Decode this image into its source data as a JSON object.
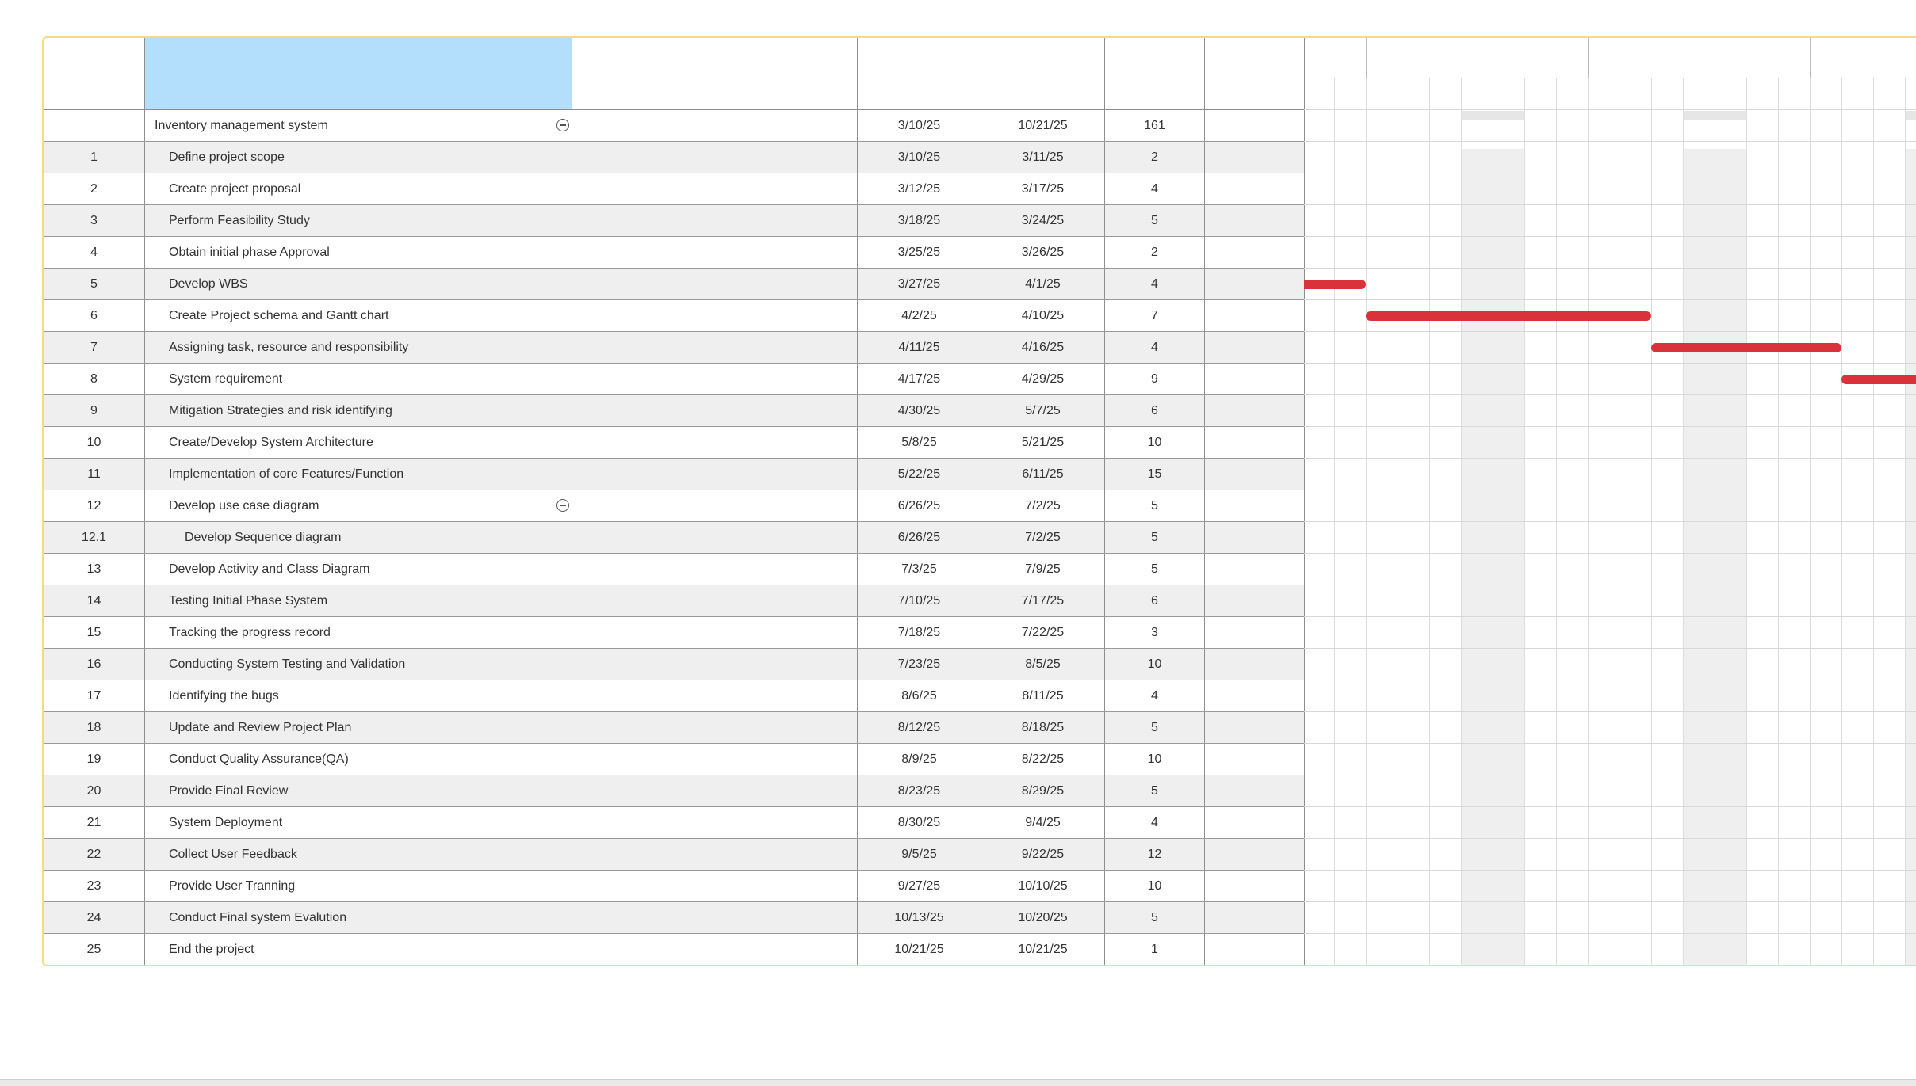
{
  "project": {
    "name": "Inventory management system",
    "start": "3/10/25",
    "finish": "10/21/25",
    "duration": "161"
  },
  "tasks": [
    {
      "id": "1",
      "name": "Define project scope",
      "start": "3/10/25",
      "finish": "3/11/25",
      "duration": "2"
    },
    {
      "id": "2",
      "name": "Create project proposal",
      "start": "3/12/25",
      "finish": "3/17/25",
      "duration": "4"
    },
    {
      "id": "3",
      "name": "Perform Feasibility Study",
      "start": "3/18/25",
      "finish": "3/24/25",
      "duration": "5"
    },
    {
      "id": "4",
      "name": "Obtain initial phase Approval",
      "start": "3/25/25",
      "finish": "3/26/25",
      "duration": "2"
    },
    {
      "id": "5",
      "name": "Develop WBS",
      "start": "3/27/25",
      "finish": "4/1/25",
      "duration": "4"
    },
    {
      "id": "6",
      "name": "Create Project schema and Gantt chart",
      "start": "4/2/25",
      "finish": "4/10/25",
      "duration": "7"
    },
    {
      "id": "7",
      "name": "Assigning task, resource and responsibility",
      "start": "4/11/25",
      "finish": "4/16/25",
      "duration": "4"
    },
    {
      "id": "8",
      "name": "System requirement",
      "start": "4/17/25",
      "finish": "4/29/25",
      "duration": "9"
    },
    {
      "id": "9",
      "name": "Mitigation Strategies and risk identifying",
      "start": "4/30/25",
      "finish": "5/7/25",
      "duration": "6"
    },
    {
      "id": "10",
      "name": "Create/Develop System Architecture",
      "start": "5/8/25",
      "finish": "5/21/25",
      "duration": "10"
    },
    {
      "id": "11",
      "name": "Implementation of core Features/Function",
      "start": "5/22/25",
      "finish": "6/11/25",
      "duration": "15"
    },
    {
      "id": "12",
      "name": "Develop use case diagram",
      "start": "6/26/25",
      "finish": "7/2/25",
      "duration": "5",
      "collapsible": true
    },
    {
      "id": "12.1",
      "name": "Develop Sequence diagram",
      "start": "6/26/25",
      "finish": "7/2/25",
      "duration": "5",
      "sub": true
    },
    {
      "id": "13",
      "name": "Develop Activity and Class Diagram",
      "start": "7/3/25",
      "finish": "7/9/25",
      "duration": "5"
    },
    {
      "id": "14",
      "name": "Testing Initial Phase System",
      "start": "7/10/25",
      "finish": "7/17/25",
      "duration": "6"
    },
    {
      "id": "15",
      "name": "Tracking the progress record",
      "start": "7/18/25",
      "finish": "7/22/25",
      "duration": "3"
    },
    {
      "id": "16",
      "name": "Conducting System Testing and Validation",
      "start": "7/23/25",
      "finish": "8/5/25",
      "duration": "10"
    },
    {
      "id": "17",
      "name": "Identifying the bugs",
      "start": "8/6/25",
      "finish": "8/11/25",
      "duration": "4"
    },
    {
      "id": "18",
      "name": "Update and Review Project Plan",
      "start": "8/12/25",
      "finish": "8/18/25",
      "duration": "5"
    },
    {
      "id": "19",
      "name": "Conduct Quality Assurance(QA)",
      "start": "8/9/25",
      "finish": "8/22/25",
      "duration": "10"
    },
    {
      "id": "20",
      "name": "Provide Final Review",
      "start": "8/23/25",
      "finish": "8/29/25",
      "duration": "5"
    },
    {
      "id": "21",
      "name": "System Deployment",
      "start": "8/30/25",
      "finish": "9/4/25",
      "duration": "4"
    },
    {
      "id": "22",
      "name": "Collect User Feedback",
      "start": "9/5/25",
      "finish": "9/22/25",
      "duration": "12"
    },
    {
      "id": "23",
      "name": "Provide User Tranning",
      "start": "9/27/25",
      "finish": "10/10/25",
      "duration": "10"
    },
    {
      "id": "24",
      "name": "Conduct Final system Evalution",
      "start": "10/13/25",
      "finish": "10/20/25",
      "duration": "5"
    },
    {
      "id": "25",
      "name": "End the project",
      "start": "10/21/25",
      "finish": "10/21/25",
      "duration": "1"
    }
  ],
  "colors": {
    "bar": "#d9323a",
    "selected_header": "#b3dffd",
    "frame_border": "#f3d98a",
    "weekend_band": "#efefef"
  }
}
